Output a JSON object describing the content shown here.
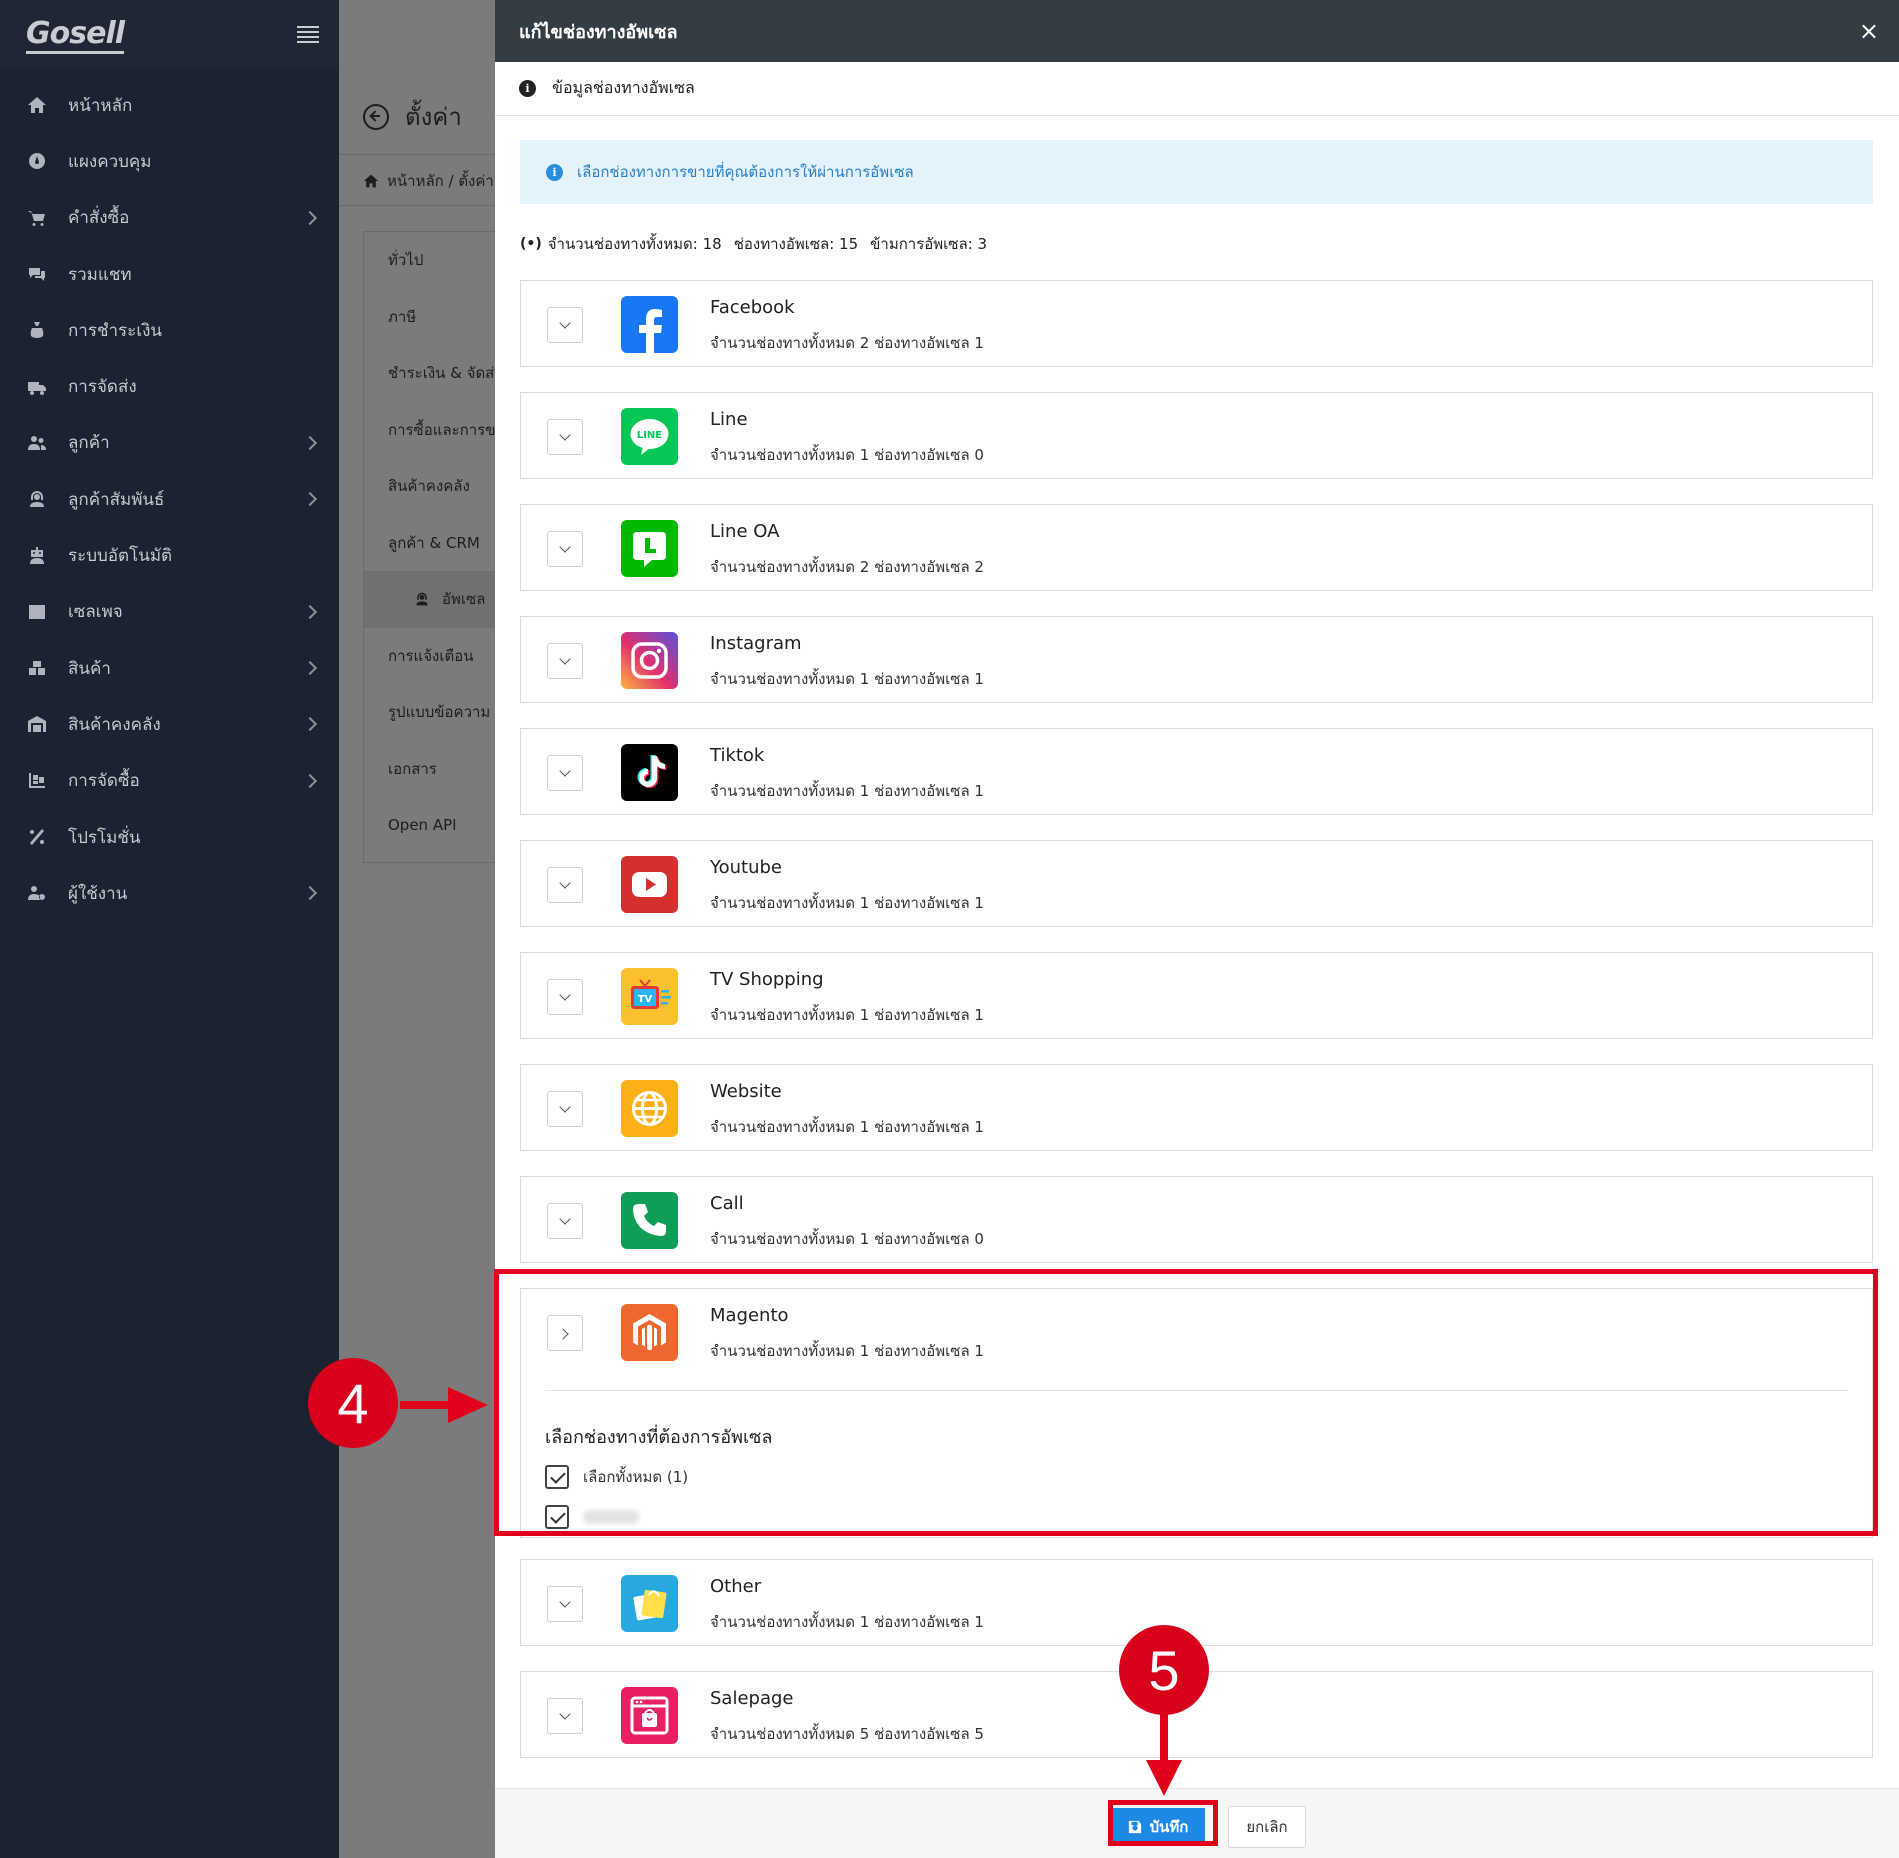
{
  "sidebar": {
    "logo": "Gosell",
    "items": [
      {
        "label": "หน้าหลัก",
        "icon": "home-icon",
        "chevron": false
      },
      {
        "label": "แผงควบคุม",
        "icon": "dashboard-icon",
        "chevron": false
      },
      {
        "label": "คำสั่งซื้อ",
        "icon": "cart-icon",
        "chevron": true
      },
      {
        "label": "รวมแชท",
        "icon": "chat-icon",
        "chevron": false
      },
      {
        "label": "การชำระเงิน",
        "icon": "money-bag-icon",
        "chevron": false
      },
      {
        "label": "การจัดส่ง",
        "icon": "truck-icon",
        "chevron": false
      },
      {
        "label": "ลูกค้า",
        "icon": "users-icon",
        "chevron": true
      },
      {
        "label": "ลูกค้าสัมพันธ์",
        "icon": "headset-icon",
        "chevron": true
      },
      {
        "label": "ระบบอัตโนมัติ",
        "icon": "robot-icon",
        "chevron": false
      },
      {
        "label": "เซลเพจ",
        "icon": "page-icon",
        "chevron": true
      },
      {
        "label": "สินค้า",
        "icon": "boxes-icon",
        "chevron": true
      },
      {
        "label": "สินค้าคงคลัง",
        "icon": "warehouse-icon",
        "chevron": true
      },
      {
        "label": "การจัดซื้อ",
        "icon": "purchase-icon",
        "chevron": true
      },
      {
        "label": "โปรโมชั่น",
        "icon": "percent-icon",
        "chevron": false
      },
      {
        "label": "ผู้ใช้งาน",
        "icon": "users-cog-icon",
        "chevron": true
      }
    ]
  },
  "settings": {
    "title": "ตั้งค่า",
    "breadcrumb": "หน้าหลัก / ตั้งค่า",
    "items": [
      "ทั่วไป",
      "ภาษี",
      "ชำระเงิน & จัดส่ง",
      "การซื้อและการขาย",
      "สินค้าคงคลัง",
      "ลูกค้า & CRM",
      "อัพเซล",
      "การแจ้งเตือน",
      "รูปแบบข้อความ",
      "เอกสาร",
      "Open API"
    ]
  },
  "modal": {
    "title": "แก้ไขช่องทางอัพเซล",
    "close": "×",
    "section_title": "ข้อมูลช่องทางอัพเซล",
    "alert": "เลือกช่องทางการขายที่คุณต้องการให้ผ่านการอัพเซล",
    "summary": {
      "total": "จำนวนช่องทางทั้งหมด: 18",
      "upsell": "ช่องทางอัพเซล: 15",
      "skip": "ข้ามการอัพเซล: 3"
    },
    "channels": [
      {
        "name": "Facebook",
        "count": "จำนวนช่องทางทั้งหมด 2 ช่องทางอัพเซล 1"
      },
      {
        "name": "Line",
        "count": "จำนวนช่องทางทั้งหมด 1 ช่องทางอัพเซล 0"
      },
      {
        "name": "Line OA",
        "count": "จำนวนช่องทางทั้งหมด 2 ช่องทางอัพเซล 2"
      },
      {
        "name": "Instagram",
        "count": "จำนวนช่องทางทั้งหมด 1 ช่องทางอัพเซล 1"
      },
      {
        "name": "Tiktok",
        "count": "จำนวนช่องทางทั้งหมด 1 ช่องทางอัพเซล 1"
      },
      {
        "name": "Youtube",
        "count": "จำนวนช่องทางทั้งหมด 1 ช่องทางอัพเซล 1"
      },
      {
        "name": "TV Shopping",
        "count": "จำนวนช่องทางทั้งหมด 1 ช่องทางอัพเซล 1"
      },
      {
        "name": "Website",
        "count": "จำนวนช่องทางทั้งหมด 1 ช่องทางอัพเซล 1"
      },
      {
        "name": "Call",
        "count": "จำนวนช่องทางทั้งหมด 1 ช่องทางอัพเซล 0"
      },
      {
        "name": "Magento",
        "count": "จำนวนช่องทางทั้งหมด 1 ช่องทางอัพเซล 1"
      },
      {
        "name": "Other",
        "count": "จำนวนช่องทางทั้งหมด 1 ช่องทางอัพเซล 1"
      },
      {
        "name": "Salepage",
        "count": "จำนวนช่องทางทั้งหมด 5 ช่องทางอัพเซล 5"
      }
    ],
    "expanded": {
      "label": "เลือกช่องทางที่ต้องการอัพเซล",
      "select_all": "เลือกทั้งหมด (1)"
    },
    "save_label": "บันทึก",
    "cancel_label": "ยกเลิก"
  },
  "annotations": {
    "step4": "4",
    "step5": "5"
  },
  "colors": {
    "highlight": "#e0001b",
    "primary": "#1e88e5",
    "header": "#353d44",
    "sidebar": "#1c2230"
  }
}
